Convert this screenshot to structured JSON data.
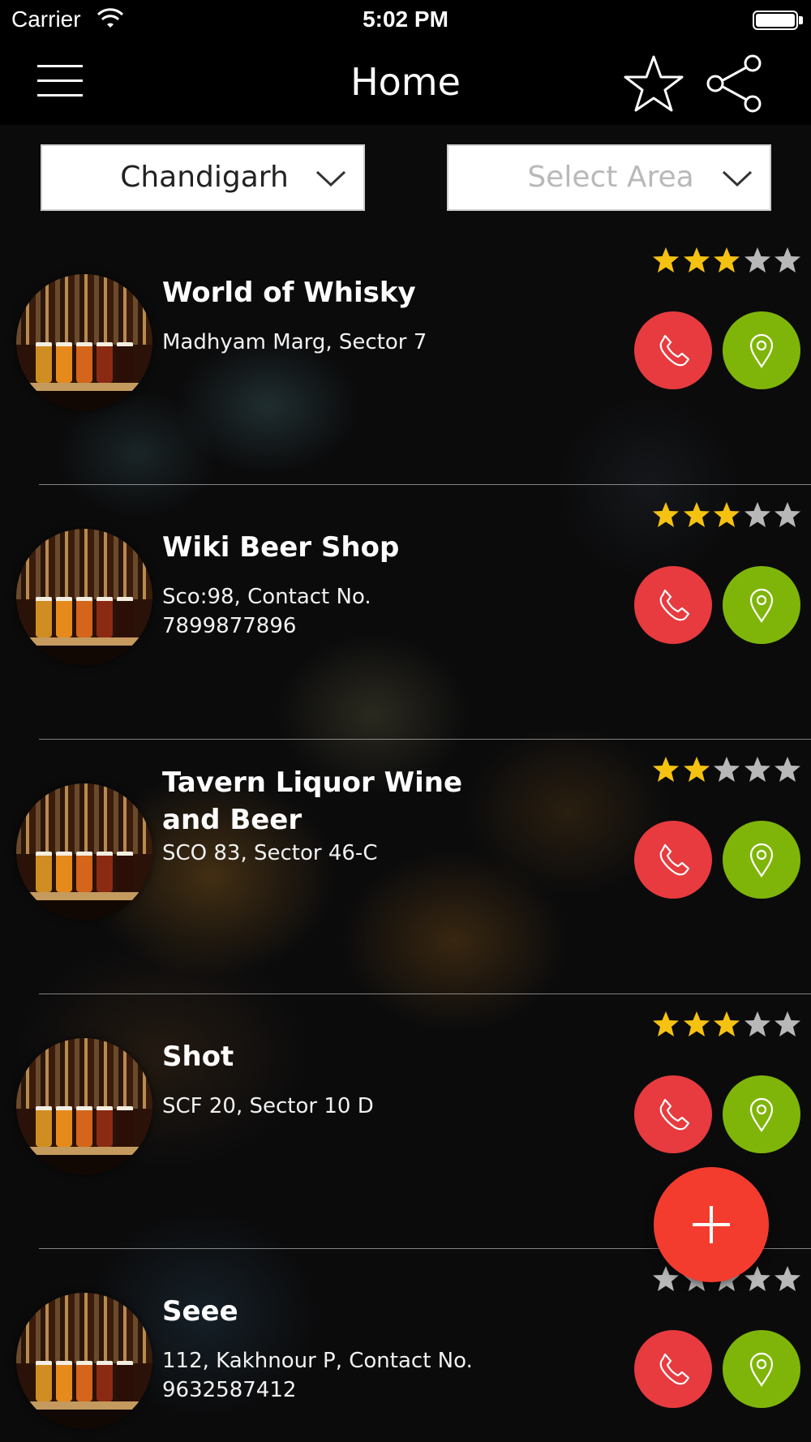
{
  "status_bar": {
    "carrier": "Carrier",
    "time": "5:02 PM"
  },
  "nav": {
    "title": "Home",
    "menu_icon": "hamburger-icon",
    "favorite_icon": "star-outline-icon",
    "share_icon": "share-icon"
  },
  "filters": {
    "city": {
      "value": "Chandigarh"
    },
    "area": {
      "placeholder": "Select Area"
    }
  },
  "colors": {
    "call_button": "#e73b3f",
    "map_button": "#7fb509",
    "fab": "#f33c2e",
    "star_filled": "#f5c211",
    "star_empty": "#b8b8b8"
  },
  "shops": [
    {
      "name": "World of Whisky",
      "address": "Madhyam Marg, Sector 7",
      "rating": 3,
      "max_rating": 5
    },
    {
      "name": "Wiki Beer Shop",
      "address": "Sco:98, Contact No. 7899877896",
      "rating": 3,
      "max_rating": 5
    },
    {
      "name": "Tavern Liquor Wine and Beer",
      "address": "SCO 83, Sector 46-C",
      "rating": 2,
      "max_rating": 5
    },
    {
      "name": "Shot",
      "address": "SCF 20, Sector 10 D",
      "rating": 3,
      "max_rating": 5
    },
    {
      "name": "Seee",
      "address": "112, Kakhnour P, Contact No. 9632587412",
      "rating": 0,
      "max_rating": 5
    }
  ],
  "fab": {
    "icon": "plus-icon"
  }
}
